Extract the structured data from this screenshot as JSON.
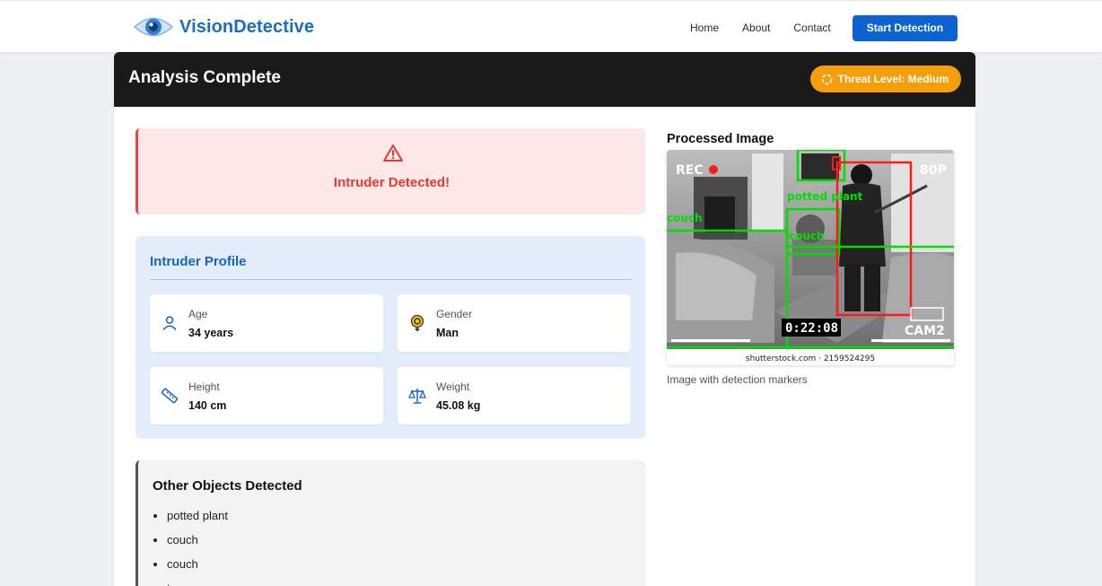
{
  "brand": {
    "name": "VisionDetective",
    "logo_icon": "eye-logo-icon"
  },
  "nav": {
    "home": "Home",
    "about": "About",
    "contact": "Contact",
    "cta": "Start Detection"
  },
  "header": {
    "title": "Analysis Complete",
    "threat_label": "Threat Level: Medium",
    "threat_color": "#f59e0b"
  },
  "alert": {
    "text": "Intruder Detected!",
    "icon": "warning-triangle-icon",
    "color": "#e53935"
  },
  "profile": {
    "title": "Intruder Profile",
    "age": {
      "label": "Age",
      "value": "34 years",
      "icon": "person-icon"
    },
    "gender": {
      "label": "Gender",
      "value": "Man",
      "icon": "male-symbol-icon"
    },
    "height": {
      "label": "Height",
      "value": "140 cm",
      "icon": "ruler-icon"
    },
    "weight": {
      "label": "Weight",
      "value": "45.08 kg",
      "icon": "scale-icon"
    }
  },
  "objects": {
    "title": "Other Objects Detected",
    "items": [
      "potted plant",
      "couch",
      "couch",
      "tv"
    ]
  },
  "processed": {
    "title": "Processed Image",
    "caption": "Image with detection markers",
    "overlay": {
      "rec": "REC",
      "resolution": "80P",
      "timestamp": "0:22:08",
      "camera": "CAM2",
      "watermark": "shutterstock.com · 2159524295",
      "labels": {
        "potted_plant": "potted plant",
        "couch_left": "couch",
        "couch_mid": "couch"
      }
    }
  }
}
